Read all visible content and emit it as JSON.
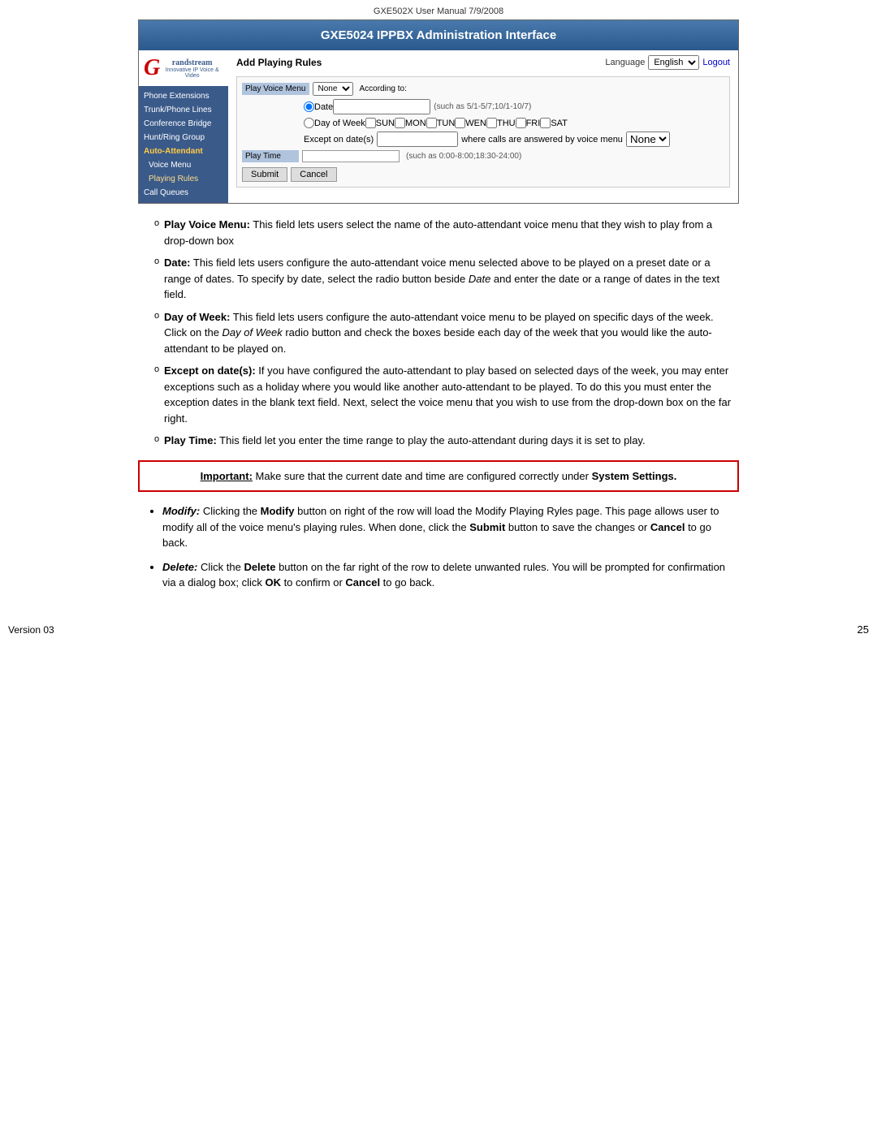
{
  "header": {
    "doc_title": "GXE502X User Manual 7/9/2008"
  },
  "admin": {
    "title": "GXE5024 IPPBX Administration Interface",
    "sidebar": {
      "logo_g": "G",
      "logo_sub": "randstream",
      "logo_tagline": "Innovative IP Voice & Video",
      "nav_items": [
        {
          "label": "Phone Extensions",
          "active": false,
          "sub": false
        },
        {
          "label": "Trunk/Phone Lines",
          "active": false,
          "sub": false
        },
        {
          "label": "Conference Bridge",
          "active": false,
          "sub": false
        },
        {
          "label": "Hunt/Ring Group",
          "active": false,
          "sub": false
        },
        {
          "label": "Auto-Attendant",
          "active": true,
          "sub": false
        },
        {
          "label": "Voice Menu",
          "active": false,
          "sub": true
        },
        {
          "label": "Playing Rules",
          "active": true,
          "sub": true
        },
        {
          "label": "Call Queues",
          "active": false,
          "sub": false
        }
      ]
    },
    "top_bar": {
      "title": "Add Playing Rules",
      "language_label": "Language",
      "language_value": "English",
      "logout_label": "Logout"
    },
    "form": {
      "play_voice_menu_label": "Play Voice Menu",
      "play_voice_menu_value": "None",
      "according_to_label": "According to:",
      "date_label": "Date",
      "date_hint": "(such as 5/1-5/7;10/1-10/7)",
      "day_of_week_label": "Day of Week",
      "days": [
        "SUN",
        "MON",
        "TUN",
        "WEN",
        "THU",
        "FRI",
        "SAT"
      ],
      "except_on_dates_label": "Except on date(s)",
      "where_answered_label": "where calls are answered by voice menu",
      "where_answered_value": "None",
      "play_time_label": "Play Time",
      "play_time_hint": "(such as 0:00-8:00;18:30-24:00)",
      "submit_label": "Submit",
      "cancel_label": "Cancel"
    }
  },
  "body_bullets": [
    {
      "term": "Play Voice Menu:",
      "text": "This field lets users select the name of the auto-attendant voice menu that they wish to play from a drop-down box"
    },
    {
      "term": "Date:",
      "text": "This field lets users configure the auto-attendant voice menu selected above to be played on a preset date or a range of dates. To specify by date, select the radio button beside Date and enter the date or a range of dates in the text field."
    },
    {
      "term": "Day of Week:",
      "text": "This field lets users configure the auto-attendant voice menu to be played on specific days of the week.  Click on the Day of Week radio button and check the boxes beside each day of the week that you would like the auto-attendant to be played on."
    },
    {
      "term": "Except on date(s):",
      "text": "If you have configured the auto-attendant to play based on selected days of the week, you may enter exceptions such as a holiday where you would like another auto-attendant to be played.  To do this you must enter the exception dates in the blank text field. Next, select the voice menu that you wish to use from the drop-down box on the far right."
    },
    {
      "term": "Play Time:",
      "text": "This field let you enter the time range to play the auto-attendant during days it is set to play."
    }
  ],
  "important_box": {
    "label": "Important:",
    "text": "Make sure that the current date and time are configured correctly under System Settings."
  },
  "outer_bullets": [
    {
      "term": "Modify:",
      "term_italic": true,
      "text": "Clicking the Modify button on right of the row will load the Modify Playing Ryles page. This page allows user to modify all of the voice menu's playing rules.  When done, click the Submit button to save the changes or Cancel to go back."
    },
    {
      "term": "Delete:",
      "term_italic": true,
      "text": "Click the Delete button on the far right of the row to delete unwanted rules. You will be prompted for confirmation via a dialog box; click OK to confirm or Cancel to go back."
    }
  ],
  "footer": {
    "version": "Version 03",
    "page_number": "25"
  }
}
